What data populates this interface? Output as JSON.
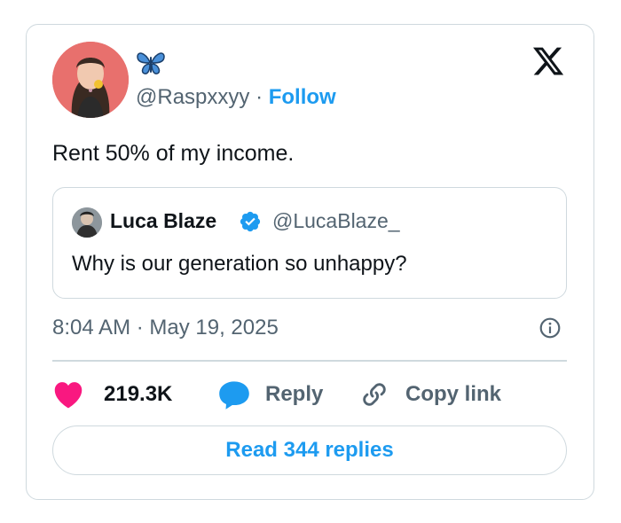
{
  "author": {
    "handle": "@Raspxxyy",
    "separator": "·",
    "follow_label": "Follow",
    "name_icon": "butterfly-emoji"
  },
  "tweet": {
    "text": "Rent 50% of my income.",
    "timestamp": "8:04 AM · May 19, 2025"
  },
  "quoted_tweet": {
    "name": "Luca Blaze",
    "handle": "@LucaBlaze_",
    "text": "Why is our generation so unhappy?",
    "verified": true
  },
  "actions": {
    "like_count": "219.3K",
    "reply_label": "Reply",
    "copy_label": "Copy link"
  },
  "read_replies_label": "Read 344 replies",
  "colors": {
    "accent": "#1d9bf0",
    "like": "#f91880",
    "border": "#cfd9de",
    "muted": "#536471",
    "text": "#0f1419"
  }
}
